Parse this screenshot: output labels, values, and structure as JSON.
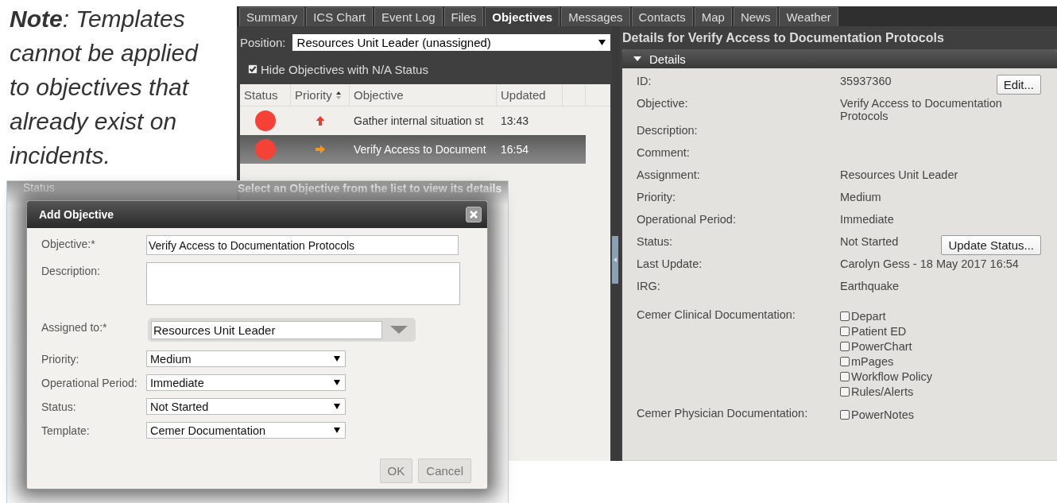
{
  "note": "**Note**: Templates cannot be applied to objectives that already exist on incidents.",
  "app": {
    "tabs": [
      {
        "label": "Summary",
        "selected": false
      },
      {
        "label": "ICS Chart",
        "selected": false
      },
      {
        "label": "Event Log",
        "selected": false
      },
      {
        "label": "Files",
        "selected": false
      },
      {
        "label": "Objectives",
        "selected": true
      },
      {
        "label": "Messages",
        "selected": false
      },
      {
        "label": "Contacts",
        "selected": false
      },
      {
        "label": "Map",
        "selected": false
      },
      {
        "label": "News",
        "selected": false
      },
      {
        "label": "Weather",
        "selected": false
      }
    ],
    "position": {
      "label": "Position:",
      "value": "Resources Unit Leader (unassigned)"
    },
    "hide_na": {
      "label": "Hide Objectives with N/A Status",
      "checked": true
    },
    "table": {
      "columns": [
        {
          "label": "Status",
          "sortable": false
        },
        {
          "label": "Priority",
          "sortable": true
        },
        {
          "label": "Objective",
          "sortable": false
        },
        {
          "label": "Updated",
          "sortable": false
        }
      ],
      "rows": [
        {
          "color": "#f44336",
          "kind": "high",
          "objective": "Gather internal situation st",
          "updated": "13:43",
          "selected": false
        },
        {
          "color": "#f44336",
          "kind": "medium",
          "objective": "Verify Access to Document",
          "updated": "16:54",
          "selected": true
        }
      ]
    },
    "details_title": "Details for Verify Access to Documentation Protocols",
    "details_section": {
      "label": "Details",
      "expanded": true
    },
    "fields": [
      {
        "kind": "text",
        "label": "ID:",
        "value": "35937360",
        "button": "Edit..."
      },
      {
        "kind": "text",
        "label": "Objective:",
        "value": "Verify Access to Documentation Protocols"
      },
      {
        "kind": "text",
        "label": "Description:"
      },
      {
        "kind": "text",
        "label": "Comment:"
      },
      {
        "kind": "text",
        "label": "Assignment:",
        "value": "Resources Unit Leader"
      },
      {
        "kind": "text",
        "label": "Priority:",
        "value": "Medium"
      },
      {
        "kind": "text",
        "label": "Operational Period:",
        "value": "Immediate"
      },
      {
        "kind": "text",
        "label": "Status:",
        "value": "Not Started",
        "button": "Update Status..."
      },
      {
        "kind": "text",
        "label": "Last Update:",
        "value": "Carolyn Gess - 18 May 2017 16:54"
      },
      {
        "kind": "text",
        "label": "IRG:",
        "value": "Earthquake"
      },
      {
        "kind": "checks",
        "label": "Cemer Clinical Documentation:",
        "options": [
          {
            "label": "Depart",
            "checked": false
          },
          {
            "label": "Patient ED",
            "checked": false
          },
          {
            "label": "PowerChart",
            "checked": false
          },
          {
            "label": "mPages",
            "checked": false
          },
          {
            "label": "Workflow Policy",
            "checked": false
          },
          {
            "label": "Rules/Alerts",
            "checked": false
          }
        ]
      },
      {
        "kind": "checks",
        "label": "Cemer Physician Documentation:",
        "options": [
          {
            "label": "PowerNotes",
            "checked": false
          }
        ]
      }
    ]
  },
  "backdrop": {
    "column_label": "Status",
    "hint": "Select an Objective from the list to view its details"
  },
  "dialog": {
    "title": "Add Objective",
    "fields": [
      {
        "kind": "input",
        "label": "Objective:*",
        "value": "Verify Access to Documentation Protocols"
      },
      {
        "kind": "textarea",
        "label": "Description:"
      },
      {
        "kind": "combo",
        "label": "Assigned to:*",
        "value": "Resources Unit Leader"
      },
      {
        "kind": "select",
        "label": "Priority:",
        "value": "Medium"
      },
      {
        "kind": "select",
        "label": "Operational Period:",
        "value": "Immediate"
      },
      {
        "kind": "select",
        "label": "Status:",
        "value": "Not Started"
      },
      {
        "kind": "select",
        "label": "Template:",
        "value": "Cemer Documentation"
      }
    ],
    "buttons": [
      "OK",
      "Cancel"
    ]
  }
}
